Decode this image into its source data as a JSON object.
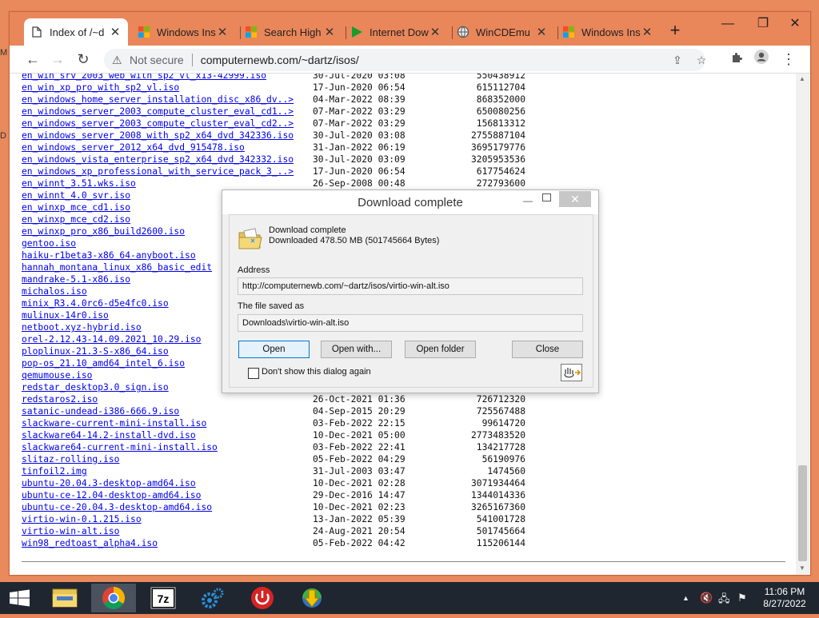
{
  "browser": {
    "tabs": [
      {
        "label": "Index of /~d",
        "icon": "page-icon",
        "active": true
      },
      {
        "label": "Windows Ins",
        "icon": "windows-logo-icon"
      },
      {
        "label": "Search High",
        "icon": "windows-logo-icon"
      },
      {
        "label": "Internet Dow",
        "icon": "idm-play-icon"
      },
      {
        "label": "WinCDEmu",
        "icon": "globe-icon"
      },
      {
        "label": "Windows Ins",
        "icon": "windows-logo-icon"
      }
    ],
    "address": {
      "security_label": "Not secure",
      "url": "computernewb.com/~dartz/isos/"
    }
  },
  "listing": [
    {
      "name": "en_win_srv_2003_web_with_sp2_vl_x13-42999.iso",
      "date": "30-Jul-2020 03:08",
      "size": "550438912"
    },
    {
      "name": "en_win_xp_pro_with_sp2_vl.iso",
      "date": "17-Jun-2020 06:54",
      "size": "615112704"
    },
    {
      "name": "en_windows_home_server_installation_disc_x86_dv..>",
      "date": "04-Mar-2022 08:39",
      "size": "868352000"
    },
    {
      "name": "en_windows_server_2003_compute_cluster_eval_cd1..>",
      "date": "07-Mar-2022 03:29",
      "size": "650080256"
    },
    {
      "name": "en_windows_server_2003_compute_cluster_eval_cd2..>",
      "date": "07-Mar-2022 03:29",
      "size": "156813312"
    },
    {
      "name": "en_windows_server_2008_with_sp2_x64_dvd_342336.iso",
      "date": "30-Jul-2020 03:08",
      "size": "2755887104"
    },
    {
      "name": "en_windows_server_2012_x64_dvd_915478.iso",
      "date": "31-Jan-2022 06:19",
      "size": "3695179776"
    },
    {
      "name": "en_windows_vista_enterprise_sp2_x64_dvd_342332.iso",
      "date": "30-Jul-2020 03:09",
      "size": "3205953536"
    },
    {
      "name": "en_windows_xp_professional_with_service_pack_3_..>",
      "date": "17-Jun-2020 06:54",
      "size": "617754624"
    },
    {
      "name": "en_winnt_3.51.wks.iso",
      "date": "26-Sep-2008 00:48",
      "size": "272793600"
    },
    {
      "name": "en_winnt_4.0_svr.iso",
      "date": "",
      "size": ""
    },
    {
      "name": "en_winxp_mce_cd1.iso",
      "date": "",
      "size": ""
    },
    {
      "name": "en_winxp_mce_cd2.iso",
      "date": "",
      "size": ""
    },
    {
      "name": "en_winxp_pro_x86_build2600.iso",
      "date": "",
      "size": ""
    },
    {
      "name": "gentoo.iso",
      "date": "",
      "size": ""
    },
    {
      "name": "haiku-r1beta3-x86_64-anyboot.iso",
      "date": "",
      "size": ""
    },
    {
      "name": "hannah_montana_linux_x86_basic_edit",
      "date": "",
      "size": ""
    },
    {
      "name": "mandrake-5.1-x86.iso",
      "date": "",
      "size": ""
    },
    {
      "name": "michalos.iso",
      "date": "",
      "size": ""
    },
    {
      "name": "minix_R3.4.0rc6-d5e4fc0.iso",
      "date": "",
      "size": ""
    },
    {
      "name": "mulinux-14r0.iso",
      "date": "",
      "size": ""
    },
    {
      "name": "netboot.xyz-hybrid.iso",
      "date": "",
      "size": ""
    },
    {
      "name": "orel-2.12.43-14.09.2021_10.29.iso",
      "date": "",
      "size": ""
    },
    {
      "name": "ploplinux-21.3-S-x86_64.iso",
      "date": "",
      "size": ""
    },
    {
      "name": "pop-os_21.10_amd64_intel_6.iso",
      "date": "",
      "size": ""
    },
    {
      "name": "qemumouse.iso",
      "date": "",
      "size": ""
    },
    {
      "name": "redstar_desktop3.0_sign.iso",
      "date": "",
      "size": ""
    },
    {
      "name": "redstaros2.iso",
      "date": "26-Oct-2021 01:36",
      "size": "726712320"
    },
    {
      "name": "satanic-undead-i386-666.9.iso",
      "date": "04-Sep-2015 20:29",
      "size": "725567488"
    },
    {
      "name": "slackware-current-mini-install.iso",
      "date": "03-Feb-2022 22:15",
      "size": "99614720"
    },
    {
      "name": "slackware64-14.2-install-dvd.iso",
      "date": "10-Dec-2021 05:00",
      "size": "2773483520"
    },
    {
      "name": "slackware64-current-mini-install.iso",
      "date": "03-Feb-2022 22:41",
      "size": "134217728"
    },
    {
      "name": "slitaz-rolling.iso",
      "date": "05-Feb-2022 04:29",
      "size": "56190976"
    },
    {
      "name": "tinfoil2.img",
      "date": "31-Jul-2003 03:47",
      "size": "1474560"
    },
    {
      "name": "ubuntu-20.04.3-desktop-amd64.iso",
      "date": "10-Dec-2021 02:28",
      "size": "3071934464"
    },
    {
      "name": "ubuntu-ce-12.04-desktop-amd64.iso",
      "date": "29-Dec-2016 14:47",
      "size": "1344014336"
    },
    {
      "name": "ubuntu-ce-20.04.3-desktop-amd64.iso",
      "date": "10-Dec-2021 02:23",
      "size": "3265167360"
    },
    {
      "name": "virtio-win-0.1.215.iso",
      "date": "13-Jan-2022 05:39",
      "size": "541001728"
    },
    {
      "name": "virtio-win-alt.iso",
      "date": "24-Aug-2021 20:54",
      "size": "501745664"
    },
    {
      "name": "win98_redtoast_alpha4.iso",
      "date": "05-Feb-2022 04:42",
      "size": "115206144"
    }
  ],
  "dialog": {
    "title": "Download complete",
    "line1": "Download complete",
    "line2": "Downloaded 478.50  MB (501745664 Bytes)",
    "address_label": "Address",
    "address_value": "http://computernewb.com/~dartz/isos/virtio-win-alt.iso",
    "saved_label": "The file saved as",
    "saved_value": "Downloads\\virtio-win-alt.iso",
    "buttons": {
      "open": "Open",
      "open_with": "Open with...",
      "open_folder": "Open folder",
      "close": "Close"
    },
    "checkbox_label": "Don't show this dialog again"
  },
  "taskbar": {
    "apps": [
      "file-explorer-icon",
      "chrome-icon",
      "7zip-icon",
      "settings-gears-icon",
      "power-icon",
      "idm-icon"
    ],
    "clock_time": "11:06 PM",
    "clock_date": "8/27/2022"
  },
  "desktop_edge": [
    "M",
    "D"
  ],
  "colors": {
    "desktop": "#e98a5c",
    "taskbar": "#1f2630",
    "link": "#0000ee"
  }
}
